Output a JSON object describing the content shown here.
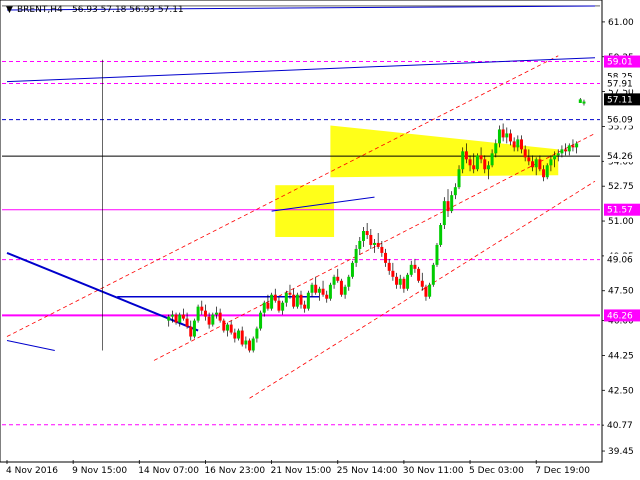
{
  "header": {
    "symbol": "BRENT,H4",
    "ohlc": "56.93 57.18 56.93 57.11"
  },
  "colors": {
    "background": "#ffffff",
    "bull": "#00cc00",
    "bear": "#ff0000",
    "wick": "#000000",
    "channel": "#ff0000",
    "trendline": "#0000cc",
    "level_pink": "#ff00ff",
    "zone": "#ffff00",
    "grid": "#c8c8c8"
  },
  "chart_data": {
    "type": "candlestick",
    "title": "BRENT,H4",
    "ylim": [
      39.0,
      62.0
    ],
    "y_ticks": [
      {
        "value": 61.0,
        "label": "61.00"
      },
      {
        "value": 59.25,
        "label": "59.25"
      },
      {
        "value": 57.5,
        "label": "57.50"
      },
      {
        "value": 55.75,
        "label": "55.75"
      },
      {
        "value": 54.0,
        "label": "54.00"
      },
      {
        "value": 52.75,
        "label": "52.75"
      },
      {
        "value": 51.0,
        "label": "51.00"
      },
      {
        "value": 49.25,
        "label": "49.25"
      },
      {
        "value": 47.5,
        "label": "47.50"
      },
      {
        "value": 46.0,
        "label": "46.00"
      },
      {
        "value": 44.25,
        "label": "44.25"
      },
      {
        "value": 42.5,
        "label": "42.50"
      },
      {
        "value": 40.75,
        "label": "40.75"
      },
      {
        "value": 39.45,
        "label": "39.45"
      }
    ],
    "x_ticks": [
      {
        "index": 0,
        "label": "4 Nov 2016"
      },
      {
        "index": 18,
        "label": "9 Nov 15:00"
      },
      {
        "index": 36,
        "label": "14 Nov 07:00"
      },
      {
        "index": 54,
        "label": "16 Nov 23:00"
      },
      {
        "index": 72,
        "label": "21 Nov 15:00"
      },
      {
        "index": 90,
        "label": "25 Nov 14:00"
      },
      {
        "index": 108,
        "label": "30 Nov 11:00"
      },
      {
        "index": 126,
        "label": "5 Dec 03:00"
      },
      {
        "index": 144,
        "label": "7 Dec 19:00"
      }
    ],
    "bar_count": 160,
    "price_labels": [
      {
        "value": 59.01,
        "label": "59.01",
        "bg": "#ff00ff",
        "fg": "#ffffff"
      },
      {
        "value": 58.25,
        "label": "58.25",
        "bg": "#ffffff",
        "fg": "#000000"
      },
      {
        "value": 57.91,
        "label": "57.91",
        "bg": "#ffffff",
        "fg": "#000000"
      },
      {
        "value": 57.11,
        "label": "57.11",
        "bg": "#000000",
        "fg": "#ffffff"
      },
      {
        "value": 56.09,
        "label": "56.09",
        "bg": "#ffffff",
        "fg": "#000000"
      },
      {
        "value": 54.26,
        "label": "54.26",
        "bg": "#ffffff",
        "fg": "#000000"
      },
      {
        "value": 51.57,
        "label": "51.57",
        "bg": "#ff00ff",
        "fg": "#ffffff"
      },
      {
        "value": 49.06,
        "label": "49.06",
        "bg": "#ffffff",
        "fg": "#000000"
      },
      {
        "value": 46.26,
        "label": "46.26",
        "bg": "#ff00ff",
        "fg": "#ffffff"
      },
      {
        "value": 40.77,
        "label": "40.77",
        "bg": "#ffffff",
        "fg": "#000000"
      }
    ],
    "horizontal_levels": [
      {
        "value": 61.8,
        "style": "solid-black-thin"
      },
      {
        "value": 59.01,
        "style": "dash-pink"
      },
      {
        "value": 57.91,
        "style": "dash-pink"
      },
      {
        "value": 56.09,
        "style": "dash-blue"
      },
      {
        "value": 54.26,
        "style": "solid-black"
      },
      {
        "value": 51.57,
        "style": "solid-pink"
      },
      {
        "value": 49.06,
        "style": "dash-pink"
      },
      {
        "value": 46.26,
        "style": "solid-pink-thick"
      },
      {
        "value": 40.77,
        "style": "dash-pink"
      }
    ],
    "candles": [
      [
        46.0,
        46.3,
        45.7,
        46.2
      ],
      [
        46.2,
        46.5,
        45.9,
        46.3
      ],
      [
        46.3,
        46.4,
        45.8,
        45.9
      ],
      [
        45.9,
        46.4,
        45.7,
        46.3
      ],
      [
        46.3,
        46.6,
        46.0,
        46.1
      ],
      [
        46.1,
        46.4,
        45.6,
        45.7
      ],
      [
        45.7,
        46.0,
        45.0,
        45.2
      ],
      [
        45.2,
        46.1,
        45.1,
        46.0
      ],
      [
        46.0,
        46.8,
        45.9,
        46.7
      ],
      [
        46.7,
        47.0,
        46.3,
        46.5
      ],
      [
        46.5,
        46.8,
        46.0,
        46.2
      ],
      [
        46.2,
        46.4,
        45.6,
        45.8
      ],
      [
        45.8,
        46.4,
        45.7,
        46.3
      ],
      [
        46.3,
        46.7,
        46.1,
        46.4
      ],
      [
        46.4,
        46.6,
        45.9,
        46.0
      ],
      [
        46.0,
        46.1,
        45.4,
        45.5
      ],
      [
        45.5,
        45.9,
        45.2,
        45.8
      ],
      [
        45.8,
        46.0,
        45.3,
        45.4
      ],
      [
        45.4,
        45.6,
        44.9,
        45.1
      ],
      [
        45.1,
        45.6,
        45.0,
        45.5
      ],
      [
        45.5,
        45.7,
        44.7,
        44.8
      ],
      [
        44.8,
        45.2,
        44.6,
        45.0
      ],
      [
        45.0,
        45.1,
        44.4,
        44.5
      ],
      [
        44.5,
        45.2,
        44.4,
        45.1
      ],
      [
        45.1,
        45.7,
        44.9,
        45.6
      ],
      [
        45.6,
        46.5,
        45.5,
        46.4
      ],
      [
        46.4,
        47.0,
        46.2,
        46.9
      ],
      [
        46.9,
        47.3,
        46.5,
        46.6
      ],
      [
        46.6,
        47.4,
        46.5,
        47.3
      ],
      [
        47.3,
        47.6,
        46.9,
        47.0
      ],
      [
        47.0,
        47.2,
        46.4,
        46.5
      ],
      [
        46.5,
        47.0,
        46.3,
        46.9
      ],
      [
        46.9,
        47.5,
        46.7,
        47.4
      ],
      [
        47.4,
        47.8,
        47.1,
        47.3
      ],
      [
        47.3,
        47.6,
        46.6,
        46.7
      ],
      [
        46.7,
        47.4,
        46.6,
        47.3
      ],
      [
        47.3,
        47.5,
        46.6,
        46.8
      ],
      [
        46.8,
        47.0,
        46.4,
        46.6
      ],
      [
        46.6,
        47.5,
        46.5,
        47.4
      ],
      [
        47.4,
        47.9,
        47.2,
        47.8
      ],
      [
        47.8,
        48.2,
        47.3,
        47.4
      ],
      [
        47.4,
        47.7,
        47.0,
        47.6
      ],
      [
        47.6,
        48.0,
        47.2,
        47.3
      ],
      [
        47.3,
        47.5,
        46.9,
        47.1
      ],
      [
        47.1,
        47.9,
        47.0,
        47.8
      ],
      [
        47.8,
        48.3,
        47.6,
        48.2
      ],
      [
        48.2,
        48.6,
        47.9,
        48.0
      ],
      [
        48.0,
        48.1,
        47.2,
        47.3
      ],
      [
        47.3,
        47.8,
        47.1,
        47.7
      ],
      [
        47.7,
        48.3,
        47.5,
        48.2
      ],
      [
        48.2,
        49.0,
        48.1,
        48.9
      ],
      [
        48.9,
        49.8,
        48.7,
        49.6
      ],
      [
        49.6,
        50.2,
        49.3,
        50.0
      ],
      [
        50.0,
        50.7,
        49.7,
        50.5
      ],
      [
        50.5,
        50.9,
        50.1,
        50.3
      ],
      [
        50.3,
        50.6,
        49.6,
        49.8
      ],
      [
        49.8,
        50.1,
        49.4,
        49.9
      ],
      [
        49.9,
        50.4,
        49.6,
        49.7
      ],
      [
        49.7,
        50.0,
        49.2,
        49.4
      ],
      [
        49.4,
        49.6,
        48.7,
        48.9
      ],
      [
        48.9,
        49.1,
        48.3,
        48.5
      ],
      [
        48.5,
        48.9,
        48.0,
        48.2
      ],
      [
        48.2,
        48.4,
        47.6,
        47.8
      ],
      [
        47.8,
        48.3,
        47.6,
        48.1
      ],
      [
        48.1,
        48.2,
        47.4,
        47.6
      ],
      [
        47.6,
        48.4,
        47.5,
        48.3
      ],
      [
        48.3,
        49.0,
        48.2,
        48.8
      ],
      [
        48.8,
        49.1,
        48.4,
        48.6
      ],
      [
        48.6,
        48.7,
        47.9,
        48.0
      ],
      [
        48.0,
        48.4,
        47.5,
        47.7
      ],
      [
        47.7,
        47.8,
        47.0,
        47.2
      ],
      [
        47.2,
        47.9,
        47.1,
        47.8
      ],
      [
        47.8,
        48.9,
        47.7,
        48.8
      ],
      [
        48.8,
        49.9,
        48.7,
        49.8
      ],
      [
        49.8,
        50.9,
        49.7,
        50.8
      ],
      [
        50.8,
        52.2,
        50.6,
        52.0
      ],
      [
        52.0,
        52.6,
        51.2,
        51.5
      ],
      [
        51.5,
        52.5,
        51.4,
        52.3
      ],
      [
        52.3,
        52.9,
        52.1,
        52.7
      ],
      [
        52.7,
        53.8,
        52.6,
        53.6
      ],
      [
        53.6,
        54.7,
        53.4,
        54.5
      ],
      [
        54.5,
        54.9,
        53.9,
        54.1
      ],
      [
        54.1,
        54.3,
        53.5,
        53.8
      ],
      [
        53.8,
        54.4,
        53.4,
        53.6
      ],
      [
        53.6,
        54.4,
        53.5,
        54.3
      ],
      [
        54.3,
        54.7,
        53.9,
        54.1
      ],
      [
        54.1,
        54.3,
        53.4,
        53.6
      ],
      [
        53.6,
        54.0,
        53.1,
        53.8
      ],
      [
        53.8,
        54.6,
        53.7,
        54.4
      ],
      [
        54.4,
        55.1,
        54.2,
        54.9
      ],
      [
        54.9,
        55.8,
        54.7,
        55.6
      ],
      [
        55.6,
        55.9,
        55.0,
        55.2
      ],
      [
        55.2,
        55.7,
        54.9,
        55.4
      ],
      [
        55.4,
        55.6,
        54.8,
        55.0
      ],
      [
        55.0,
        55.2,
        54.5,
        54.7
      ],
      [
        54.7,
        55.3,
        54.5,
        55.1
      ],
      [
        55.1,
        55.3,
        54.4,
        54.6
      ],
      [
        54.6,
        54.8,
        54.0,
        54.2
      ],
      [
        54.2,
        54.6,
        53.8,
        54.0
      ],
      [
        54.0,
        54.3,
        53.5,
        53.7
      ],
      [
        53.7,
        54.2,
        53.3,
        54.1
      ],
      [
        54.1,
        54.3,
        53.5,
        53.6
      ],
      [
        53.6,
        53.8,
        53.0,
        53.2
      ],
      [
        53.2,
        53.9,
        53.1,
        53.8
      ],
      [
        53.8,
        54.3,
        53.5,
        54.1
      ],
      [
        54.1,
        54.5,
        53.7,
        54.3
      ],
      [
        54.3,
        54.6,
        54.0,
        54.4
      ],
      [
        54.4,
        54.8,
        54.2,
        54.6
      ],
      [
        54.6,
        54.9,
        54.3,
        54.5
      ],
      [
        54.5,
        54.9,
        54.3,
        54.8
      ],
      [
        54.8,
        55.1,
        54.5,
        54.7
      ],
      [
        54.7,
        55.0,
        54.4,
        54.9
      ]
    ],
    "last_candles": [
      [
        56.93,
        57.18,
        56.93,
        57.11
      ],
      [
        56.9,
        57.1,
        56.8,
        57.0
      ]
    ]
  }
}
